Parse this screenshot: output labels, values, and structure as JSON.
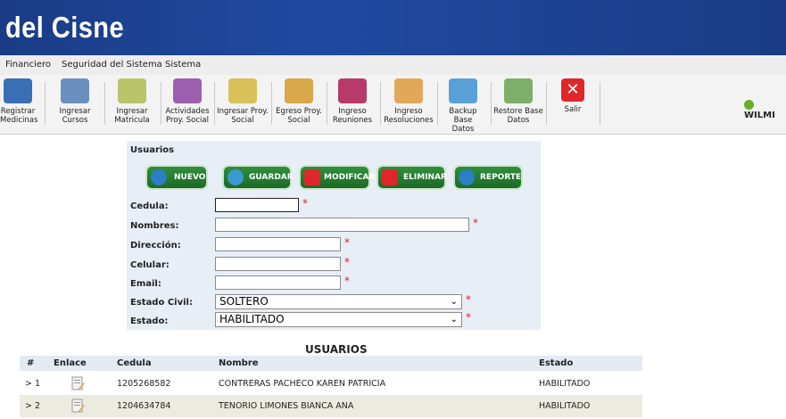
{
  "banner": {
    "title": "del Cisne"
  },
  "menu": [
    "Financiero",
    "Seguridad del Sistema",
    "Sistema"
  ],
  "toolbar": [
    {
      "label1": "Registrar",
      "label2": "Medicinas",
      "icon": "medicine-icon",
      "color": "#3a6fb5"
    },
    {
      "label1": "Ingresar",
      "label2": "Cursos",
      "icon": "course-icon",
      "color": "#6a8fbf"
    },
    {
      "label1": "Ingresar",
      "label2": "Matricula",
      "icon": "enrollment-icon",
      "color": "#b9c46a"
    },
    {
      "label1": "Actividades",
      "label2": "Proy. Social",
      "icon": "activities-icon",
      "color": "#9c5fb0"
    },
    {
      "label1": "Ingresar Proy.",
      "label2": "Social",
      "icon": "project-icon",
      "color": "#d9c15a"
    },
    {
      "label1": "Egreso Proy.",
      "label2": "Social",
      "icon": "exit-project-icon",
      "color": "#d8a84a"
    },
    {
      "label1": "Ingreso",
      "label2": "Reuniones",
      "icon": "meetings-icon",
      "color": "#b73a6a"
    },
    {
      "label1": "Ingreso",
      "label2": "Resoluciones",
      "icon": "resolutions-icon",
      "color": "#e2a85a"
    },
    {
      "label1": "Backup Base",
      "label2": "Datos",
      "icon": "backup-icon",
      "color": "#5aa0d8"
    },
    {
      "label1": "Restore Base",
      "label2": "Datos",
      "icon": "restore-icon",
      "color": "#7fae6a"
    },
    {
      "label1": "Salir",
      "label2": "",
      "icon": "exit-icon",
      "color": "#e0262a"
    }
  ],
  "user": {
    "name": "WILMI"
  },
  "form": {
    "title": "Usuarios",
    "buttons": [
      "NUEVO",
      "GUARDAR",
      "MODIFICAR",
      "ELIMINAR",
      "REPORTE"
    ],
    "labels": {
      "cedula": "Cedula:",
      "nombres": "Nombres:",
      "direccion": "Dirección:",
      "celular": "Celular:",
      "email": "Email:",
      "estado_civil": "Estado Civil:",
      "estado": "Estado:"
    },
    "values": {
      "cedula": "",
      "nombres": "",
      "direccion": "",
      "celular": "",
      "email": "",
      "estado_civil": "SOLTERO",
      "estado": "HABILITADO"
    },
    "required_mark": "*"
  },
  "grid": {
    "title": "USUARIOS",
    "headers": [
      "#",
      "Enlace",
      "Cedula",
      "Nombre",
      "Estado"
    ],
    "rows": [
      {
        "num": "1",
        "cedula": "1205268582",
        "nombre": "CONTRERAS PACHECO KAREN PATRICIA",
        "estado": "HABILITADO"
      },
      {
        "num": "2",
        "cedula": "1204634784",
        "nombre": "TENORIO LIMONES BIANCA ANA",
        "estado": "HABILITADO"
      }
    ]
  }
}
